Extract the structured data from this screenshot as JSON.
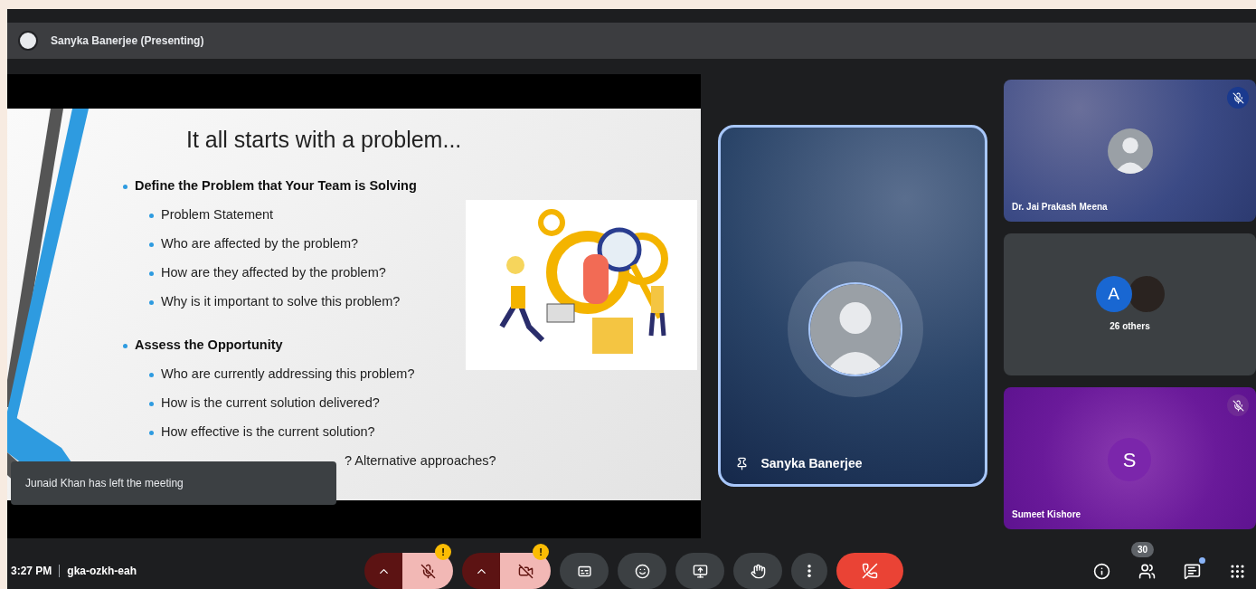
{
  "presenting_bar": {
    "label": "Sanyka Banerjee (Presenting)"
  },
  "slide": {
    "title": "It all starts with a problem...",
    "sections": [
      {
        "heading": "Define the Problem that Your Team is Solving",
        "items": [
          {
            "kind": "bullet",
            "text": "Problem Statement"
          },
          {
            "kind": "bullet",
            "text": "Who are affected by the problem?"
          },
          {
            "kind": "bullet",
            "text": "How are they affected by the problem?"
          },
          {
            "kind": "bullet",
            "text": "Why is it important to solve this problem?"
          }
        ]
      },
      {
        "heading": "Assess the Opportunity",
        "items": [
          {
            "kind": "bullet",
            "text": "Who are currently addressing this problem?"
          },
          {
            "kind": "bullet",
            "text": "How is the current solution delivered?"
          },
          {
            "kind": "bullet",
            "text": "How effective is the current solution?"
          },
          {
            "kind": "covered",
            "text": "? Alternative approaches?"
          }
        ]
      }
    ]
  },
  "toast": {
    "text": "Junaid Khan has left the meeting"
  },
  "presenter_tile": {
    "name": "Sanyka Banerjee",
    "pinned": true,
    "speaking": true
  },
  "tiles": [
    {
      "kind": "photo",
      "name": "Dr. Jai Prakash Meena",
      "muted": true
    },
    {
      "kind": "group",
      "initial": "A",
      "label": "26 others"
    },
    {
      "kind": "initial",
      "name": "Sumeet Kishore",
      "initial": "S",
      "muted": true
    }
  ],
  "meeting": {
    "time": "3:27 PM",
    "code": "gka-ozkh-eah"
  },
  "controls": [
    {
      "kind": "mic",
      "off": true,
      "warning": "!"
    },
    {
      "kind": "camera",
      "off": true,
      "warning": "!"
    },
    {
      "kind": "captions"
    },
    {
      "kind": "emoji"
    },
    {
      "kind": "present"
    },
    {
      "kind": "hand"
    },
    {
      "kind": "more"
    },
    {
      "kind": "end"
    }
  ],
  "side_icons": [
    {
      "kind": "info"
    },
    {
      "kind": "people",
      "badge": "30"
    },
    {
      "kind": "chat",
      "dot": true
    },
    {
      "kind": "activities"
    }
  ]
}
